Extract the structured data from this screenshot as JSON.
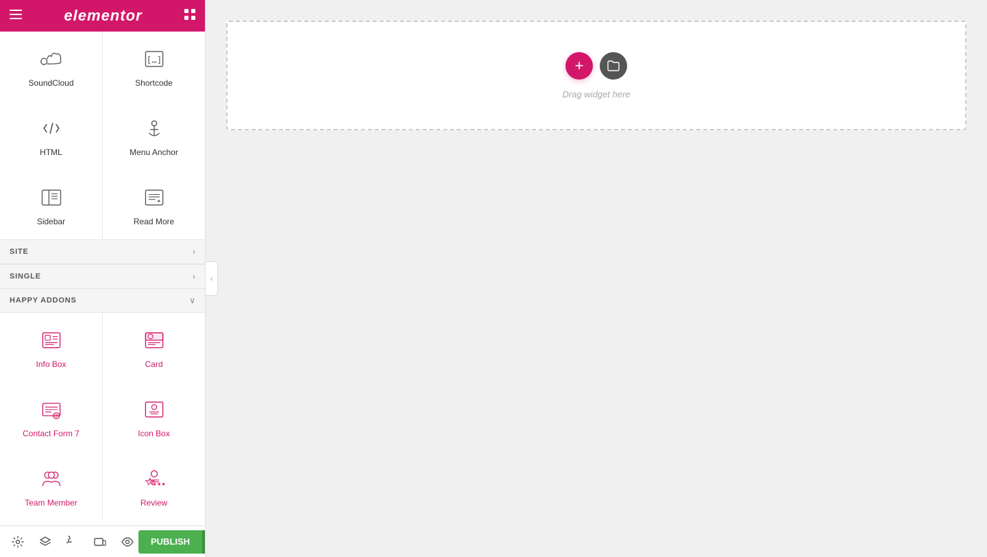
{
  "header": {
    "logo": "elementor",
    "hamburger_label": "≡",
    "grid_label": "⊞"
  },
  "widgets_row1": [
    {
      "id": "soundcloud",
      "label": "SoundCloud",
      "icon_type": "soundcloud"
    },
    {
      "id": "shortcode",
      "label": "Shortcode",
      "icon_type": "shortcode"
    }
  ],
  "widgets_row2": [
    {
      "id": "html",
      "label": "HTML",
      "icon_type": "html"
    },
    {
      "id": "menu-anchor",
      "label": "Menu Anchor",
      "icon_type": "anchor"
    }
  ],
  "widgets_row3": [
    {
      "id": "sidebar",
      "label": "Sidebar",
      "icon_type": "sidebar"
    },
    {
      "id": "read-more",
      "label": "Read More",
      "icon_type": "readmore"
    }
  ],
  "sections": [
    {
      "id": "site",
      "label": "SITE",
      "chevron": "›"
    },
    {
      "id": "single",
      "label": "SINGLE",
      "chevron": "›"
    }
  ],
  "happy_addons": {
    "label": "HAPPY ADDONS",
    "chevron": "∨"
  },
  "happy_widgets_row1": [
    {
      "id": "info-box",
      "label": "Info Box",
      "icon_type": "infobox"
    },
    {
      "id": "card",
      "label": "Card",
      "icon_type": "card"
    }
  ],
  "happy_widgets_row2": [
    {
      "id": "contact-form-7",
      "label": "Contact Form 7",
      "icon_type": "contactform"
    },
    {
      "id": "icon-box",
      "label": "Icon Box",
      "icon_type": "iconbox"
    }
  ],
  "happy_widgets_row3": [
    {
      "id": "team-member",
      "label": "Team Member",
      "icon_type": "team"
    },
    {
      "id": "review",
      "label": "Review",
      "icon_type": "review"
    }
  ],
  "bottom": {
    "icons": [
      "settings",
      "layers",
      "history",
      "responsive",
      "view"
    ],
    "publish_label": "PUBLISH"
  },
  "canvas": {
    "drop_text": "Drag widget here",
    "add_btn_label": "+",
    "folder_btn_label": "⊡"
  }
}
